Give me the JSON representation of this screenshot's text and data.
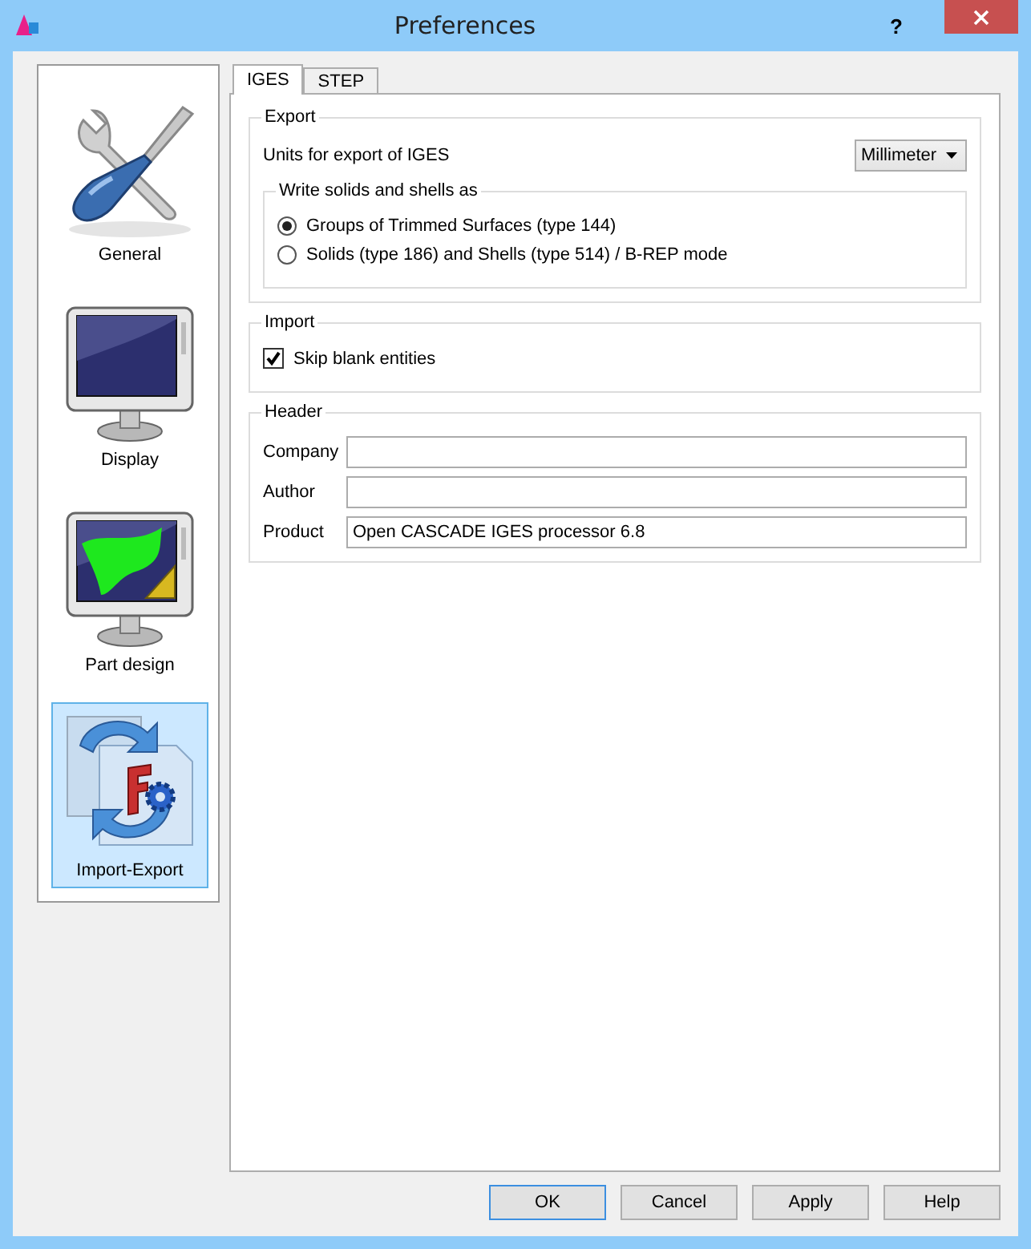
{
  "window": {
    "title": "Preferences",
    "help": "?"
  },
  "sidebar": {
    "items": [
      {
        "label": "General",
        "kind": "tools",
        "selected": false
      },
      {
        "label": "Display",
        "kind": "monitor",
        "selected": false
      },
      {
        "label": "Part design",
        "kind": "part",
        "selected": false
      },
      {
        "label": "Import-Export",
        "kind": "importexport",
        "selected": true
      }
    ]
  },
  "tabs": [
    {
      "label": "IGES",
      "selected": true
    },
    {
      "label": "STEP",
      "selected": false
    }
  ],
  "export": {
    "title": "Export",
    "units_label": "Units for export of IGES",
    "units_value": "Millimeter",
    "write_group": {
      "title": "Write solids and shells as",
      "options": [
        {
          "label": "Groups of Trimmed Surfaces (type 144)",
          "selected": true
        },
        {
          "label": "Solids (type 186) and Shells (type 514) / B-REP mode",
          "selected": false
        }
      ]
    }
  },
  "import": {
    "title": "Import",
    "options": [
      {
        "label": "Skip blank entities",
        "checked": true
      }
    ]
  },
  "header": {
    "title": "Header",
    "fields": [
      {
        "label": "Company"
      },
      {
        "label": "Author"
      },
      {
        "label": "Product",
        "value": "Open CASCADE IGES processor 6.8"
      }
    ]
  },
  "buttons": [
    {
      "label": "OK",
      "default": true
    },
    {
      "label": "Cancel",
      "default": false
    },
    {
      "label": "Apply",
      "default": false
    },
    {
      "label": "Help",
      "default": false
    }
  ]
}
